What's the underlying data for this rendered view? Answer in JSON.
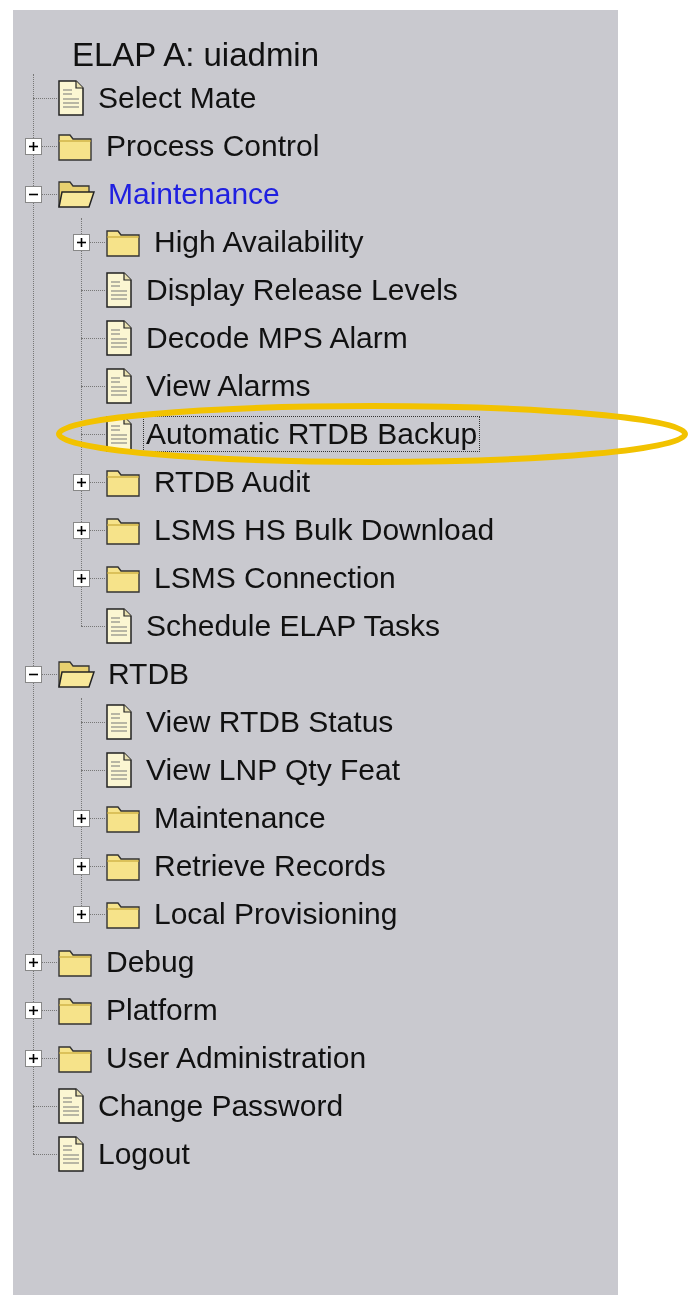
{
  "tree": {
    "title": "ELAP A: uiadmin",
    "items": [
      {
        "kind": "page",
        "label": "Select Mate",
        "active": false,
        "selected": false,
        "circled": false
      },
      {
        "kind": "folder",
        "label": "Process Control",
        "expanded": false,
        "active": false,
        "selected": false,
        "circled": false
      },
      {
        "kind": "folder",
        "label": "Maintenance",
        "expanded": true,
        "active": true,
        "selected": false,
        "circled": false,
        "children": [
          {
            "kind": "folder",
            "label": "High Availability",
            "expanded": false,
            "active": false,
            "selected": false,
            "circled": false
          },
          {
            "kind": "page",
            "label": "Display Release Levels",
            "active": false,
            "selected": false,
            "circled": false
          },
          {
            "kind": "page",
            "label": "Decode MPS Alarm",
            "active": false,
            "selected": false,
            "circled": false
          },
          {
            "kind": "page",
            "label": "View Alarms",
            "active": false,
            "selected": false,
            "circled": false
          },
          {
            "kind": "page",
            "label": "Automatic RTDB Backup",
            "active": false,
            "selected": true,
            "circled": true
          },
          {
            "kind": "folder",
            "label": "RTDB Audit",
            "expanded": false,
            "active": false,
            "selected": false,
            "circled": false
          },
          {
            "kind": "folder",
            "label": "LSMS HS Bulk Download",
            "expanded": false,
            "active": false,
            "selected": false,
            "circled": false
          },
          {
            "kind": "folder",
            "label": "LSMS Connection",
            "expanded": false,
            "active": false,
            "selected": false,
            "circled": false
          },
          {
            "kind": "page",
            "label": "Schedule ELAP Tasks",
            "active": false,
            "selected": false,
            "circled": false
          }
        ]
      },
      {
        "kind": "folder",
        "label": "RTDB",
        "expanded": true,
        "active": false,
        "selected": false,
        "circled": false,
        "children": [
          {
            "kind": "page",
            "label": "View RTDB Status",
            "active": false,
            "selected": false,
            "circled": false
          },
          {
            "kind": "page",
            "label": "View LNP Qty Feat",
            "active": false,
            "selected": false,
            "circled": false
          },
          {
            "kind": "folder",
            "label": "Maintenance",
            "expanded": false,
            "active": false,
            "selected": false,
            "circled": false
          },
          {
            "kind": "folder",
            "label": "Retrieve Records",
            "expanded": false,
            "active": false,
            "selected": false,
            "circled": false
          },
          {
            "kind": "folder",
            "label": "Local Provisioning",
            "expanded": false,
            "active": false,
            "selected": false,
            "circled": false
          }
        ]
      },
      {
        "kind": "folder",
        "label": "Debug",
        "expanded": false,
        "active": false,
        "selected": false,
        "circled": false
      },
      {
        "kind": "folder",
        "label": "Platform",
        "expanded": false,
        "active": false,
        "selected": false,
        "circled": false
      },
      {
        "kind": "folder",
        "label": "User Administration",
        "expanded": false,
        "active": false,
        "selected": false,
        "circled": false
      },
      {
        "kind": "page",
        "label": "Change Password",
        "active": false,
        "selected": false,
        "circled": false
      },
      {
        "kind": "page",
        "label": "Logout",
        "active": false,
        "selected": false,
        "circled": false
      }
    ]
  }
}
